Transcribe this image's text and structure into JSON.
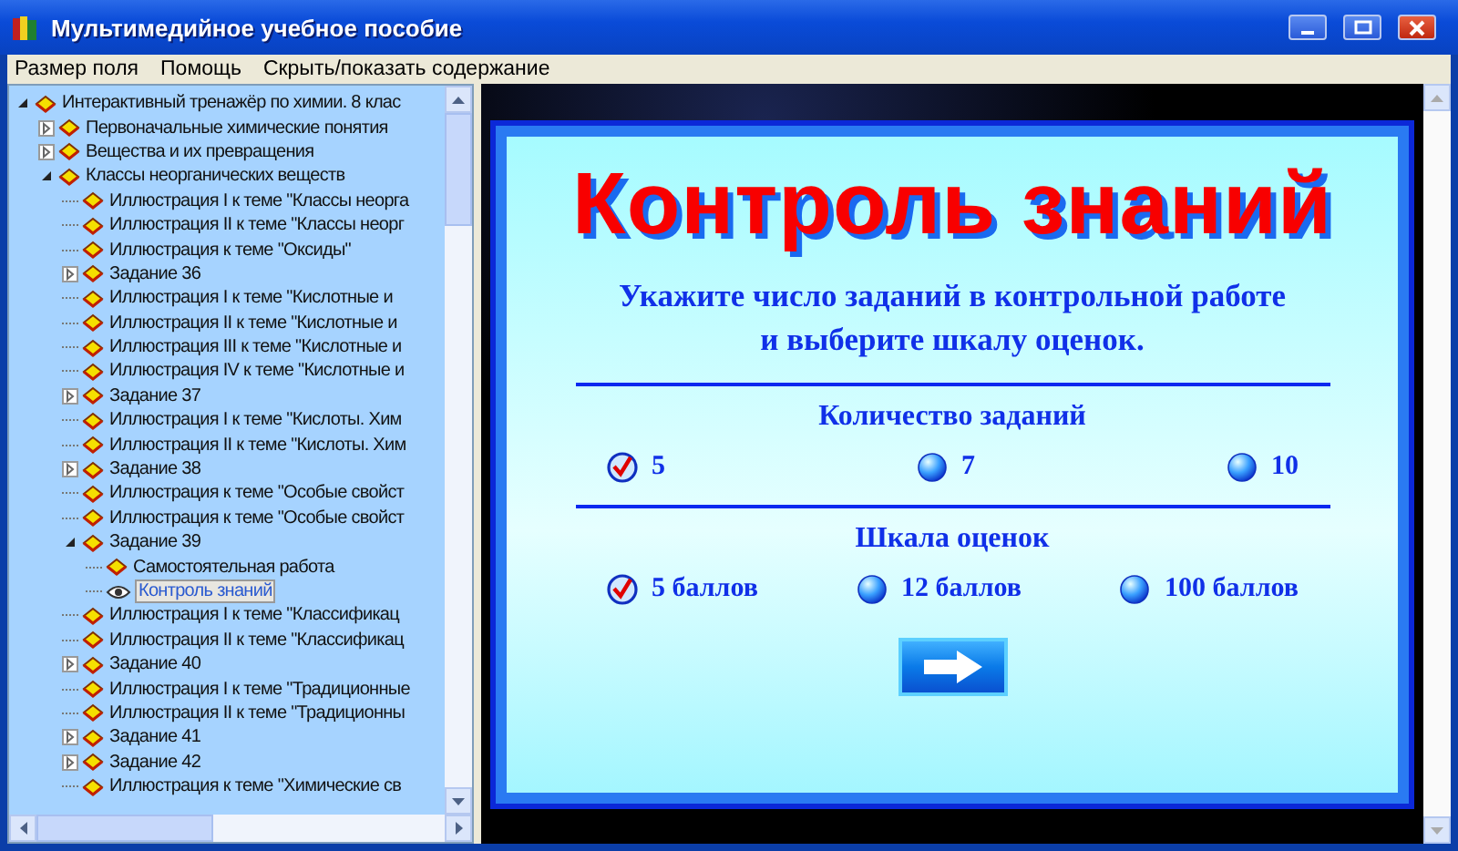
{
  "window": {
    "title": "Мультимедийное учебное пособие"
  },
  "menu": [
    {
      "label": "Размер поля"
    },
    {
      "label": "Помощь"
    },
    {
      "label": "Скрыть/показать содержание"
    }
  ],
  "tree": [
    {
      "label": "Интерактивный тренажёр по химии. 8 клас",
      "expanded": true,
      "selected": false,
      "children": [
        {
          "label": "Первоначальные химические понятия",
          "expanded": false,
          "selected": false
        },
        {
          "label": "Вещества и их превращения",
          "expanded": false,
          "selected": false
        },
        {
          "label": "Классы неорганических веществ",
          "expanded": true,
          "selected": false,
          "children": [
            {
              "label": "Иллюстрация I к теме \"Классы неорга",
              "selected": false
            },
            {
              "label": "Иллюстрация II к теме \"Классы неорг",
              "selected": false
            },
            {
              "label": "Иллюстрация к теме \"Оксиды\"",
              "selected": false
            },
            {
              "label": "Задание 36",
              "expanded": false,
              "selected": false
            },
            {
              "label": "Иллюстрация I к теме \"Кислотные и",
              "selected": false
            },
            {
              "label": "Иллюстрация II к теме \"Кислотные и",
              "selected": false
            },
            {
              "label": "Иллюстрация III к теме \"Кислотные и",
              "selected": false
            },
            {
              "label": "Иллюстрация IV к теме \"Кислотные и",
              "selected": false
            },
            {
              "label": "Задание 37",
              "expanded": false,
              "selected": false
            },
            {
              "label": "Иллюстрация I к теме \"Кислоты. Хим",
              "selected": false
            },
            {
              "label": "Иллюстрация II к теме \"Кислоты. Хим",
              "selected": false
            },
            {
              "label": "Задание 38",
              "expanded": false,
              "selected": false
            },
            {
              "label": "Иллюстрация к теме \"Особые свойст",
              "selected": false
            },
            {
              "label": "Иллюстрация к теме \"Особые свойст",
              "selected": false
            },
            {
              "label": "Задание 39",
              "expanded": true,
              "selected": false,
              "children": [
                {
                  "label": "Самостоятельная работа",
                  "selected": false
                },
                {
                  "label": "Контроль знаний",
                  "selected": true
                }
              ]
            },
            {
              "label": "Иллюстрация I к теме \"Классификац",
              "selected": false
            },
            {
              "label": "Иллюстрация II к теме \"Классификац",
              "selected": false
            },
            {
              "label": "Задание 40",
              "expanded": false,
              "selected": false
            },
            {
              "label": "Иллюстрация I к теме \"Традиционные",
              "selected": false
            },
            {
              "label": "Иллюстрация II к теме \"Традиционны",
              "selected": false
            },
            {
              "label": "Задание 41",
              "expanded": false,
              "selected": false
            },
            {
              "label": "Задание 42",
              "expanded": false,
              "selected": false
            },
            {
              "label": "Иллюстрация к теме \"Химические св",
              "selected": false
            }
          ]
        }
      ]
    }
  ],
  "panel": {
    "title": "Контроль знаний",
    "instruction": [
      "Укажите число заданий в контрольной работе",
      "и выберите шкалу оценок."
    ],
    "groups": [
      {
        "heading": "Количество заданий",
        "options": [
          {
            "label": "5",
            "selected": true
          },
          {
            "label": "7",
            "selected": false
          },
          {
            "label": "10",
            "selected": false
          }
        ]
      },
      {
        "heading": "Шкала оценок",
        "options": [
          {
            "label": "5 баллов",
            "selected": true
          },
          {
            "label": "12 баллов",
            "selected": false
          },
          {
            "label": "100 баллов",
            "selected": false
          }
        ]
      }
    ]
  }
}
